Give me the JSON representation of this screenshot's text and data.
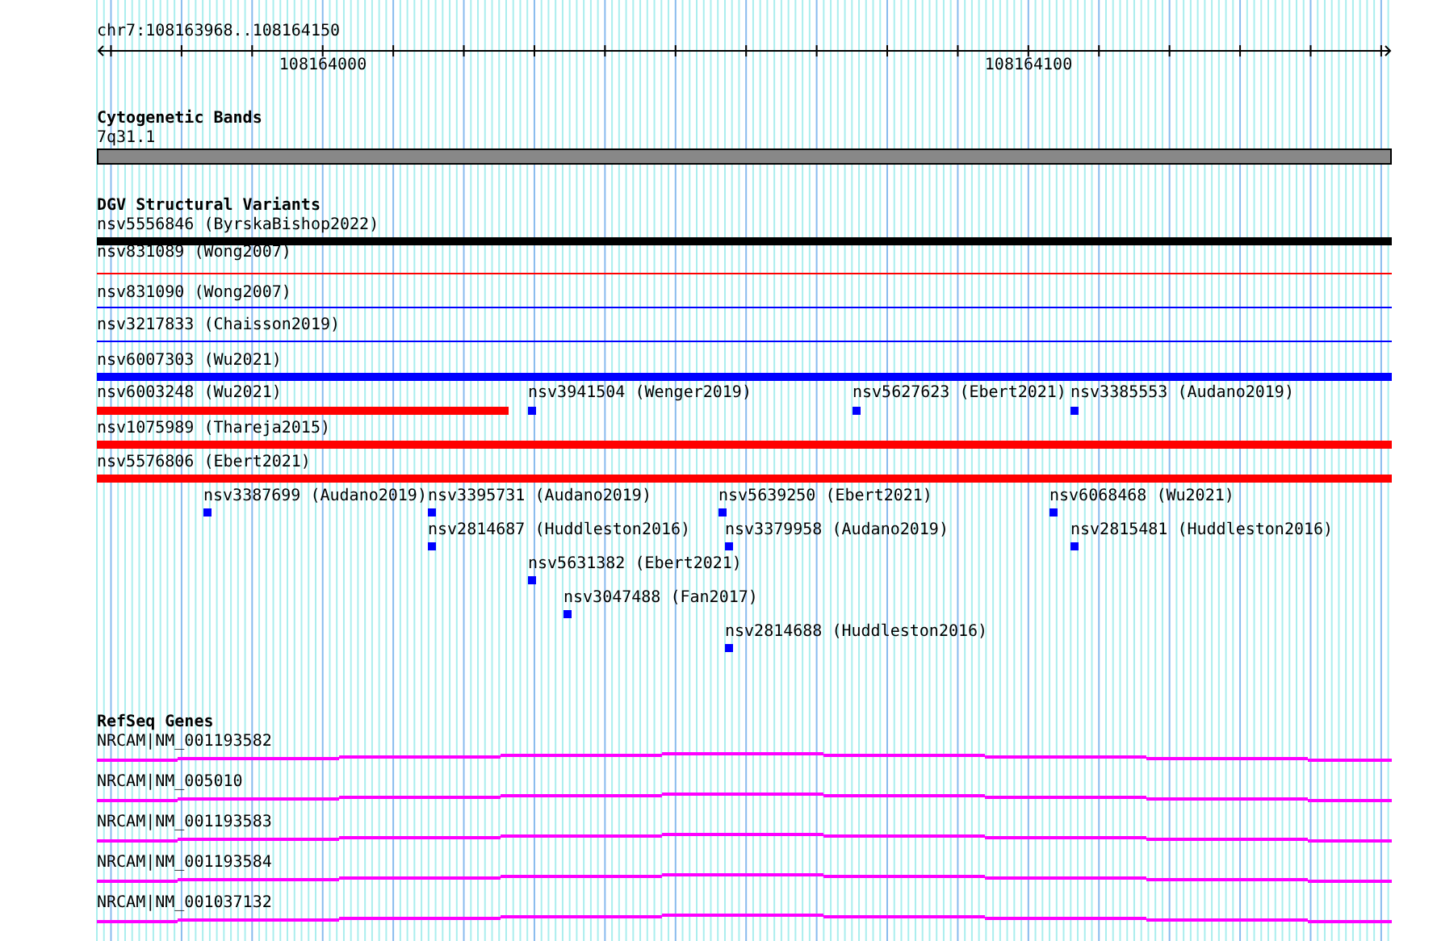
{
  "location": "chr7:108163968..108164150",
  "ruler": {
    "tick_labels": [
      "108164000",
      "108164100"
    ]
  },
  "tracks": [
    {
      "title": "Cytogenetic Bands",
      "features": [
        {
          "kind": "band",
          "label": "7q31.1",
          "color": "#888888"
        }
      ]
    },
    {
      "title": "DGV Structural Variants",
      "features": [
        {
          "kind": "bar",
          "label": "nsv5556846 (ByrskaBishop2022)",
          "color": "#000000"
        },
        {
          "kind": "line",
          "label": "nsv831089 (Wong2007)",
          "color": "#ff0000"
        },
        {
          "kind": "line",
          "label": "nsv831090 (Wong2007)",
          "color": "#0000ff"
        },
        {
          "kind": "line",
          "label": "nsv3217833 (Chaisson2019)",
          "color": "#0000ff"
        },
        {
          "kind": "bar",
          "label": "nsv6007303 (Wu2021)",
          "color": "#0000ff"
        },
        {
          "kind": "bar",
          "label": "nsv6003248 (Wu2021)",
          "color": "#ff0000"
        },
        {
          "kind": "dot",
          "label": "nsv3941504 (Wenger2019)",
          "color": "#0000ff"
        },
        {
          "kind": "dot",
          "label": "nsv5627623 (Ebert2021)",
          "color": "#0000ff"
        },
        {
          "kind": "dot",
          "label": "nsv3385553 (Audano2019)",
          "color": "#0000ff"
        },
        {
          "kind": "bar",
          "label": "nsv1075989 (Thareja2015)",
          "color": "#ff0000"
        },
        {
          "kind": "bar",
          "label": "nsv5576806 (Ebert2021)",
          "color": "#ff0000"
        },
        {
          "kind": "dot",
          "label": "nsv3387699 (Audano2019)",
          "color": "#0000ff"
        },
        {
          "kind": "dot",
          "label": "nsv3395731 (Audano2019)",
          "color": "#0000ff"
        },
        {
          "kind": "dot",
          "label": "nsv5639250 (Ebert2021)",
          "color": "#0000ff"
        },
        {
          "kind": "dot",
          "label": "nsv6068468 (Wu2021)",
          "color": "#0000ff"
        },
        {
          "kind": "dot",
          "label": "nsv2814687 (Huddleston2016)",
          "color": "#0000ff"
        },
        {
          "kind": "dot",
          "label": "nsv3379958 (Audano2019)",
          "color": "#0000ff"
        },
        {
          "kind": "dot",
          "label": "nsv2815481 (Huddleston2016)",
          "color": "#0000ff"
        },
        {
          "kind": "dot",
          "label": "nsv5631382 (Ebert2021)",
          "color": "#0000ff"
        },
        {
          "kind": "dot",
          "label": "nsv3047488 (Fan2017)",
          "color": "#0000ff"
        },
        {
          "kind": "dot",
          "label": "nsv2814688 (Huddleston2016)",
          "color": "#0000ff"
        }
      ]
    },
    {
      "title": "RefSeq Genes",
      "features": [
        {
          "kind": "gene",
          "label": "NRCAM|NM_001193582",
          "color": "#ff00ff"
        },
        {
          "kind": "gene",
          "label": "NRCAM|NM_005010",
          "color": "#ff00ff"
        },
        {
          "kind": "gene",
          "label": "NRCAM|NM_001193583",
          "color": "#ff00ff"
        },
        {
          "kind": "gene",
          "label": "NRCAM|NM_001193584",
          "color": "#ff00ff"
        },
        {
          "kind": "gene",
          "label": "NRCAM|NM_001037132",
          "color": "#ff00ff"
        }
      ]
    }
  ]
}
